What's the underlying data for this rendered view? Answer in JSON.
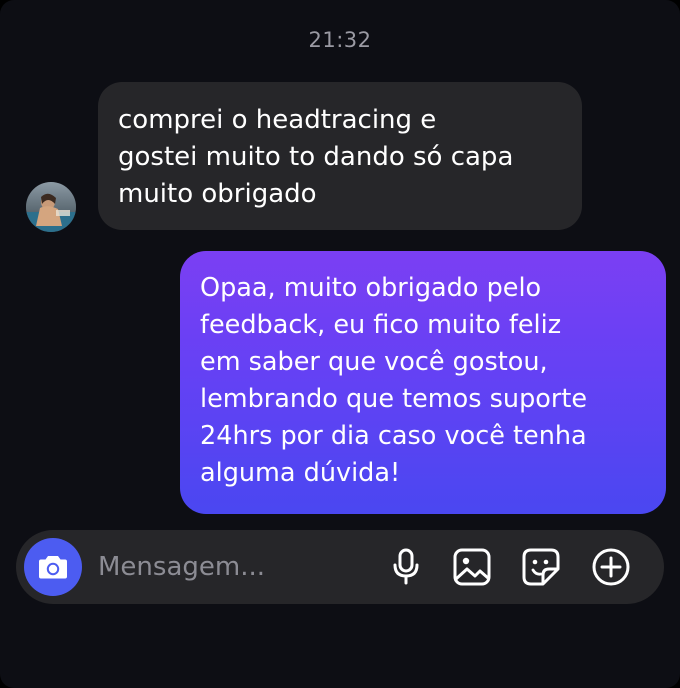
{
  "conversation": {
    "timestamp": "21:32",
    "messages": [
      {
        "direction": "incoming",
        "text": "comprei o headtracing e\ngostei muito to dando só capa\nmuito obrigado"
      },
      {
        "direction": "outgoing",
        "text": "Opaa, muito obrigado pelo\nfeedback, eu fico muito feliz\nem saber que você gostou,\nlembrando que temos suporte\n24hrs por dia caso você tenha\nalguma dúvida!"
      }
    ]
  },
  "composer": {
    "placeholder": "Mensagem...",
    "value": "",
    "icons": [
      "camera-icon",
      "microphone-icon",
      "gallery-icon",
      "sticker-icon",
      "plus-icon"
    ]
  },
  "colors": {
    "background": "#0d0e14",
    "incoming_bubble": "#262629",
    "outgoing_bubble_top": "#7b3ff3",
    "outgoing_bubble_bottom": "#4a47f1",
    "camera_button": "#4c5cf1",
    "timestamp_text": "#9a9aa3"
  }
}
